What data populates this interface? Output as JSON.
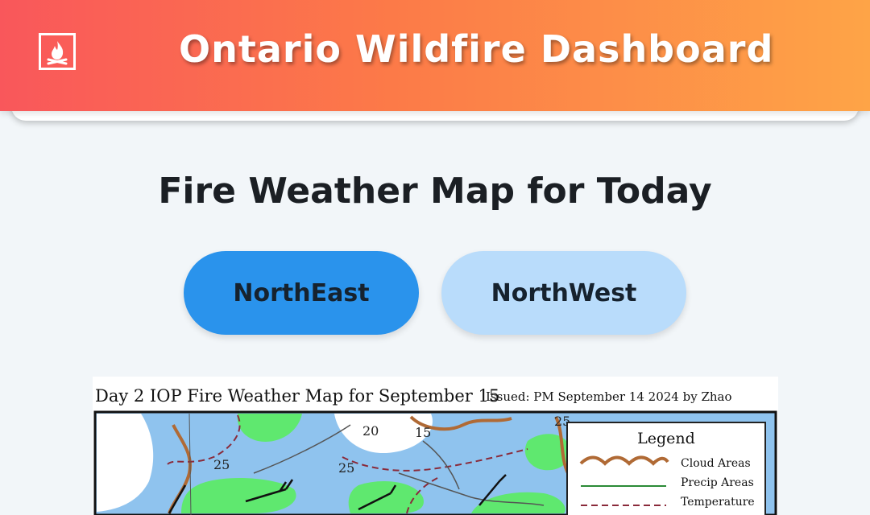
{
  "header": {
    "title": "Ontario Wildfire Dashboard",
    "logo_icon": "campfire-icon",
    "gradient": [
      "#f9575b",
      "#fea447"
    ]
  },
  "page": {
    "title": "Fire Weather Map for Today"
  },
  "regions": {
    "buttons": [
      {
        "label": "NorthEast",
        "selected": true,
        "color": "#2a93ec"
      },
      {
        "label": "NorthWest",
        "selected": false,
        "color": "#b9dcfb"
      }
    ]
  },
  "map": {
    "caption": "Day 2 IOP Fire Weather Map for September 15",
    "issued": "Issued: PM September 14 2024 by Zhao",
    "contour_labels": [
      "20",
      "15",
      "25",
      "25",
      "25"
    ],
    "legend": {
      "title": "Legend",
      "items": [
        "Cloud Areas",
        "Precip Areas",
        "Temperature"
      ]
    }
  }
}
